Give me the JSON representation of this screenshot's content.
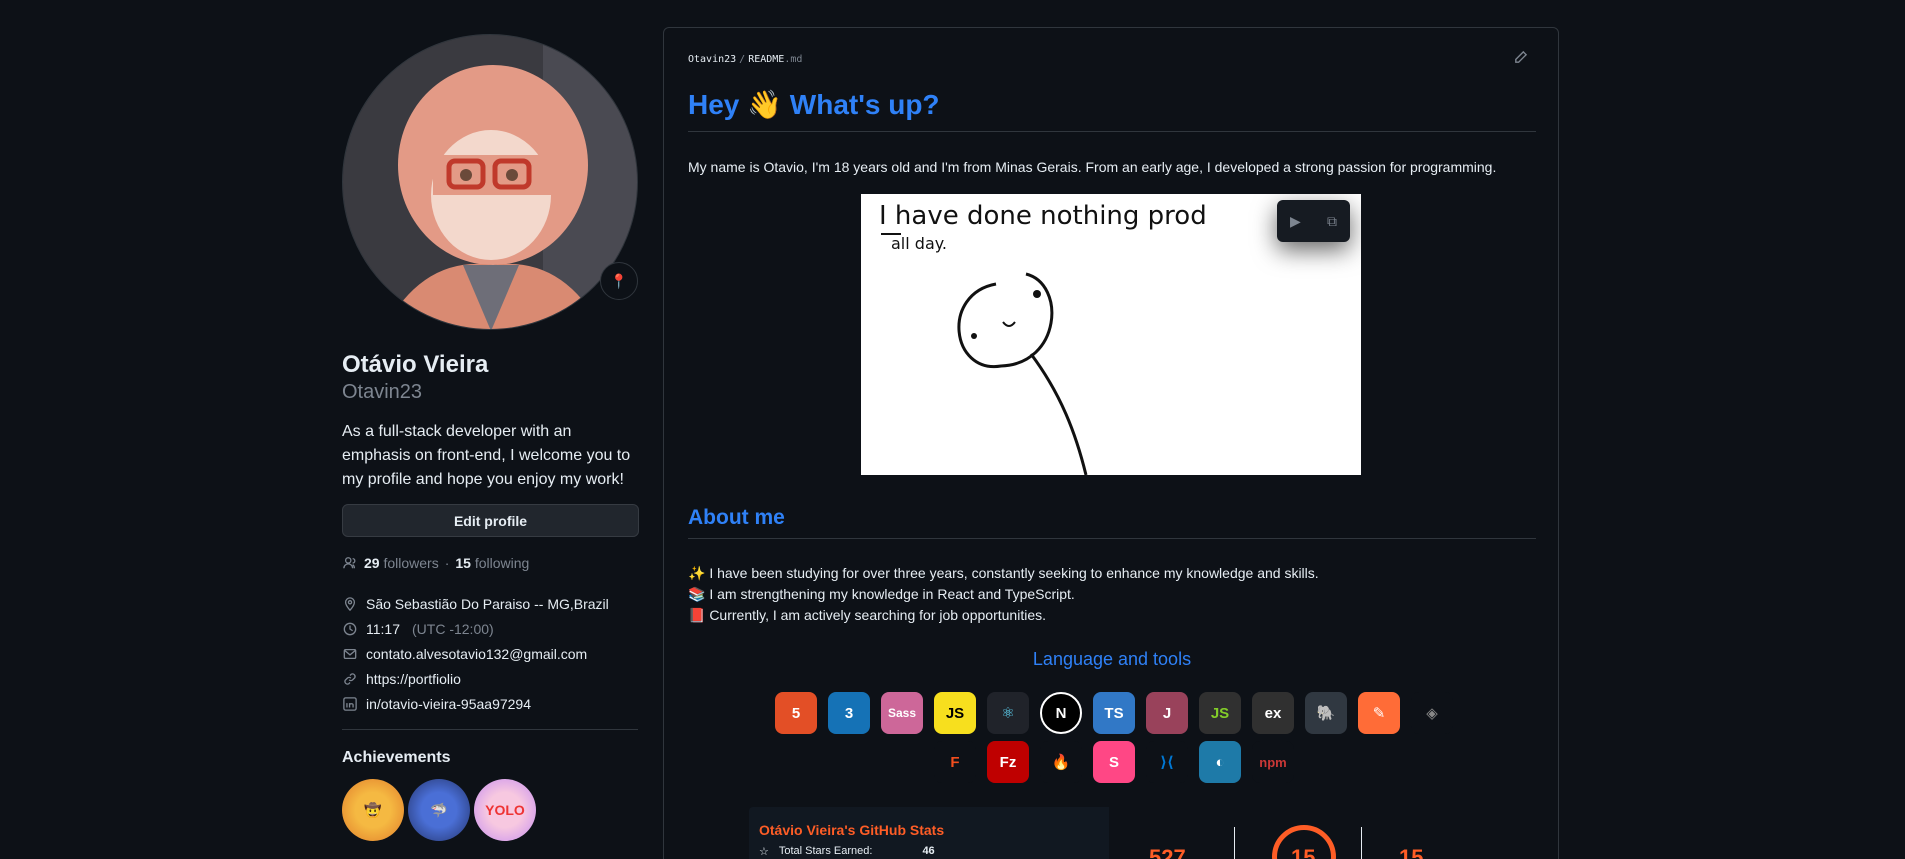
{
  "profile": {
    "name": "Otávio Vieira",
    "login": "Otavin23",
    "bio": "As a full-stack developer with an emphasis on front-end, I welcome you to my profile and hope you enjoy my work!",
    "edit_label": "Edit profile",
    "followers_count": "29",
    "followers_label": "followers",
    "dot": "·",
    "following_count": "15",
    "following_label": "following",
    "location": "São Sebastião Do Paraiso -- MG,Brazil",
    "time": "11:17",
    "timezone": "(UTC -12:00)",
    "email": "contato.alvesotavio132@gmail.com",
    "website": "https://portfiolio",
    "linkedin": "in/otavio-vieira-95aa97294",
    "achievements_title": "Achievements"
  },
  "readme": {
    "crumb_user": "Otavin23",
    "crumb_sep": "/",
    "crumb_file": "README",
    "crumb_ext": ".md",
    "heading": "Hey 👋 What's up?",
    "intro": "My name is Otavio, I'm 18 years old and I'm from Minas Gerais. From an early age, I developed a strong passion for programming.",
    "gif_text_line1": "I have done nothing prod",
    "gif_text_line2": "all day.",
    "about_title": "About me",
    "about_lines": [
      "✨ I have been studying for over three years, constantly seeking to enhance my knowledge and skills.",
      "📚 I am strengthening my knowledge in React and TypeScript.",
      "📕 Currently, I am actively searching for job opportunities."
    ],
    "tools_title": "Language and tools",
    "tools": [
      {
        "name": "html5",
        "label": "5",
        "color": "#e34f26"
      },
      {
        "name": "css3",
        "label": "3",
        "color": "#1572b6"
      },
      {
        "name": "sass",
        "label": "Sass",
        "color": "#cd6799"
      },
      {
        "name": "javascript",
        "label": "JS",
        "color": "#f7df1e"
      },
      {
        "name": "react",
        "label": "⚛",
        "color": "#20232a"
      },
      {
        "name": "nextjs",
        "label": "N",
        "color": "#000000"
      },
      {
        "name": "typescript",
        "label": "TS",
        "color": "#3178c6"
      },
      {
        "name": "jest",
        "label": "J",
        "color": "#99425b"
      },
      {
        "name": "nodejs",
        "label": "JS",
        "color": "#303030"
      },
      {
        "name": "express",
        "label": "ex",
        "color": "#303030"
      },
      {
        "name": "postgresql",
        "label": "🐘",
        "color": "#303841"
      },
      {
        "name": "postman",
        "label": "✎",
        "color": "#ff6c37"
      },
      {
        "name": "codepen",
        "label": "◈",
        "color": "#0d1117"
      },
      {
        "name": "figma",
        "label": "F",
        "color": "#0d1117"
      },
      {
        "name": "filezilla",
        "label": "Fz",
        "color": "#bf0000"
      },
      {
        "name": "firebase",
        "label": "🔥",
        "color": "#0d1117"
      },
      {
        "name": "storybook",
        "label": "S",
        "color": "#ff4785"
      },
      {
        "name": "vscode",
        "label": "⟩⟨",
        "color": "#0d1117"
      },
      {
        "name": "mariadb",
        "label": "◐",
        "color": "#1e7aa8"
      },
      {
        "name": "npm",
        "label": "npm",
        "color": "#0d1117"
      }
    ],
    "stats_title": "Otávio Vieira's GitHub Stats",
    "stats_row_label": "Total Stars Earned:",
    "stats_row_value": "46",
    "stats_num_left": "527",
    "stats_num_mid": "15",
    "stats_num_right": "15"
  }
}
